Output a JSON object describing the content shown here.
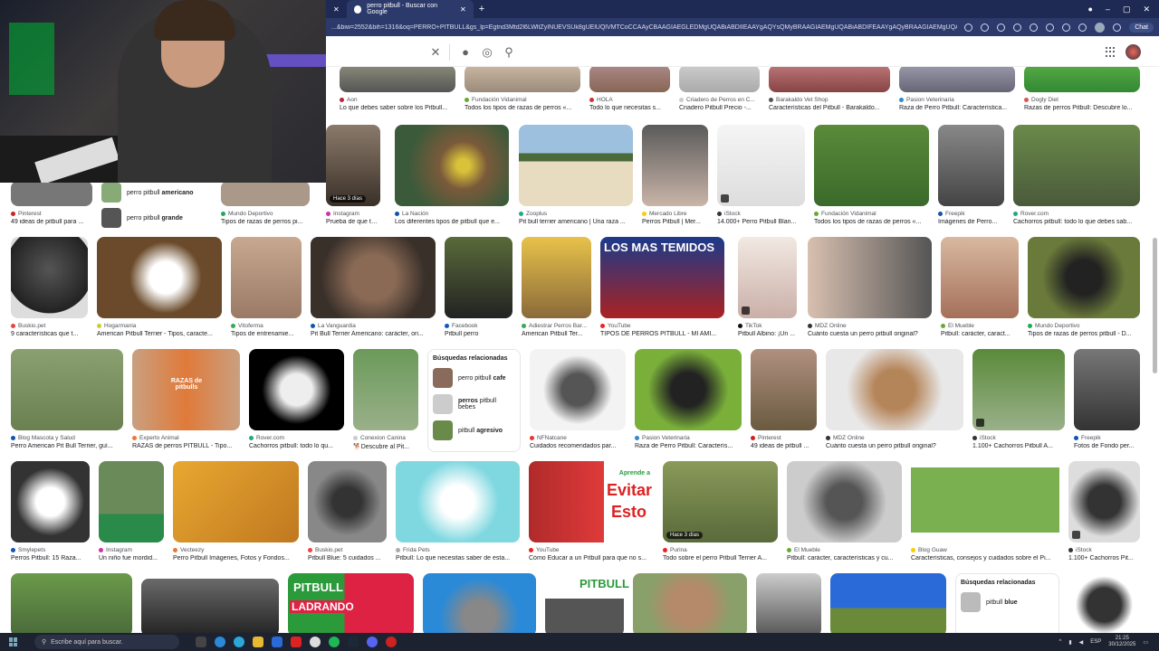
{
  "browser": {
    "tab_title": "perro pitbull - Buscar con Google",
    "url": "...&biw=2552&bih=1316&oq=PERRO+PITBULL&gs_lp=Egtnd3Mtd2l6LWltZyINUEVSUk8gUElUQlVMTCoCCAAyCBAAGIAEGLEDMgUQABiABDIIEAAYgAQYsQMyBRAAGIAEMgUQABiABDIFEAAYgAQyBRAAGIAEMgUQABiABDIFEAAYgARI",
    "chat_label": "Chat"
  },
  "search": {
    "value": ""
  },
  "results": {
    "row0": [
      {
        "source": "Aon",
        "title": "Lo que debes saber sobre los Pitbull..."
      },
      {
        "source": "Fundación Vidanimal",
        "title": "Todos los tipos de razas de perros «..."
      },
      {
        "source": "HOLA",
        "title": "Todo lo que necesitas s..."
      },
      {
        "source": "Criadero de Perros en C...",
        "title": "Criadero Pitbull Precio -..."
      },
      {
        "source": "Barakaldo Vet Shop",
        "title": "Características del Pitbull - Barakaldo..."
      },
      {
        "source": "Pasion Veterinaria",
        "title": "Raza de Perro Pitbull: Característica..."
      },
      {
        "source": "Dogly Diet",
        "title": "Razas de perros Pitbull: Descubre lo..."
      }
    ],
    "row1": [
      {
        "source": "Pinterest",
        "title": "49 ideas de pitbull para ..."
      },
      {
        "source": "Mundo Deportivo",
        "title": "Tipos de razas de perros pi..."
      },
      {
        "source": "Instagram",
        "title": "Prueba de que tod...",
        "badge": "Hace 3 días"
      },
      {
        "source": "La Nación",
        "title": "Los diferentes tipos de pitbull que e..."
      },
      {
        "source": "Zooplus",
        "title": "Pit bull terrier americano | Una raza ..."
      },
      {
        "source": "Mercado Libre",
        "title": "Perros Pitbull | Mer..."
      },
      {
        "source": "iStock",
        "title": "14.000+ Perro Pitbull Blan..."
      },
      {
        "source": "Fundación Vidanimal",
        "title": "Todos los tipos de razas de perros «..."
      },
      {
        "source": "Freepik",
        "title": "Imágenes de Perro..."
      },
      {
        "source": "Rover.com",
        "title": "Cachorros pitbull: todo lo que debes sab..."
      }
    ],
    "related_top": [
      {
        "pre": "perro pitbull ",
        "bold": "americano"
      },
      {
        "pre": "perro pitbull ",
        "bold": "grande"
      }
    ],
    "row2": [
      {
        "source": "Buskio.pet",
        "title": "9 características que t..."
      },
      {
        "source": "Hogarmania",
        "title": "American Pitbull Terrier - Tipos, caracte..."
      },
      {
        "source": "Vitoferma",
        "title": "Tipos de entrenamie..."
      },
      {
        "source": "La Vanguardia",
        "title": "Pit Bull Terrier Americano: carácter, ori..."
      },
      {
        "source": "Facebook",
        "title": "Pitbull perro"
      },
      {
        "source": "Adiestrar Perros Bar...",
        "title": "American Pitbull Ter..."
      },
      {
        "source": "YouTube",
        "title": "TIPOS DE PERROS PITBULL - MI AMI...",
        "overlay": "LOS MAS TEMIDOS"
      },
      {
        "source": "TikTok",
        "title": "Pitbull Albino: ¡Un ..."
      },
      {
        "source": "MDZ Online",
        "title": "Cuánto cuesta un perro pitbull original?"
      },
      {
        "source": "El Mueble",
        "title": "Pitbull: carácter, caract..."
      },
      {
        "source": "Mundo Deportivo",
        "title": "Tipos de razas de perros pitbull - D..."
      }
    ],
    "row3": [
      {
        "source": "Blog Mascota y Salud",
        "title": "Perro American Pit Bull Terrier, guí..."
      },
      {
        "source": "Experto Animal",
        "title": "RAZAS de perros PITBULL - Tipo...",
        "overlay": "RAZAS de pitbulls"
      },
      {
        "source": "Rover.com",
        "title": "Cachorros pitbull: todo lo qu..."
      },
      {
        "source": "Conexion Canina",
        "title": "🐕Descubre al Pit..."
      },
      {
        "source": "NFNatcane",
        "title": "Cuidados recomendados par..."
      },
      {
        "source": "Pasion Veterinaria",
        "title": "Raza de Perro Pitbull: Caracterís..."
      },
      {
        "source": "Pinterest",
        "title": "49 ideas de pitbull ..."
      },
      {
        "source": "MDZ Online",
        "title": "Cuánto cuesta un perro pitbull original?"
      },
      {
        "source": "iStock",
        "title": "1.100+ Cachorros Pitbull A..."
      },
      {
        "source": "Freepik",
        "title": "Fotos de Fondo per..."
      }
    ],
    "related_mid": {
      "heading": "Búsquedas relacionadas",
      "items": [
        {
          "pre": "perro pitbull ",
          "bold": "cafe",
          "post": ""
        },
        {
          "pre": "",
          "bold": "perros",
          "post": " pitbull bebes"
        },
        {
          "pre": "pitbull ",
          "bold": "agresivo",
          "post": ""
        }
      ]
    },
    "row4": [
      {
        "source": "Smylepets",
        "title": "Perros Pitbull: 15 Raza..."
      },
      {
        "source": "Instagram",
        "title": "Un niño fue mordid..."
      },
      {
        "source": "Vecteezy",
        "title": "Perro Pitbull Imágenes, Fotos y Fondos..."
      },
      {
        "source": "Buskio.pet",
        "title": "Pitbull Blue: 5 cuidados ..."
      },
      {
        "source": "Frida Pets",
        "title": "Pitbull: Lo que necesitas saber de esta..."
      },
      {
        "source": "YouTube",
        "title": "Cómo Educar a un Pitbull para que no s...",
        "overlay1": "Aprende a",
        "overlay2": "Evitar",
        "overlay3": "Esto"
      },
      {
        "source": "Purina",
        "title": "Todo sobre el perro Pitbull Terrier A...",
        "badge": "Hace 3 días"
      },
      {
        "source": "El Mueble",
        "title": "Pitbull: carácter, características y cu..."
      },
      {
        "source": "Blog Guaw",
        "title": "Características, consejos y cuidados sobre el Pi..."
      },
      {
        "source": "iStock",
        "title": "1.100+ Cachorros Pit..."
      }
    ],
    "row5_overlays": {
      "pitbull_a": "PITBULL",
      "pitbull_b": "LADRANDO",
      "pitbull_c": "PITBULL"
    },
    "related_bottom": {
      "heading": "Búsquedas relacionadas",
      "items": [
        {
          "pre": "pitbull ",
          "bold": "blue"
        }
      ]
    }
  },
  "taskbar": {
    "search_placeholder": "Escribe aquí para buscar.",
    "lang": "ESP",
    "time": "21:25",
    "date": "30/12/2025"
  },
  "colors": {
    "chrome": "#1f2a54",
    "taskbar": "#1d2231",
    "link": "#1a0dab"
  }
}
